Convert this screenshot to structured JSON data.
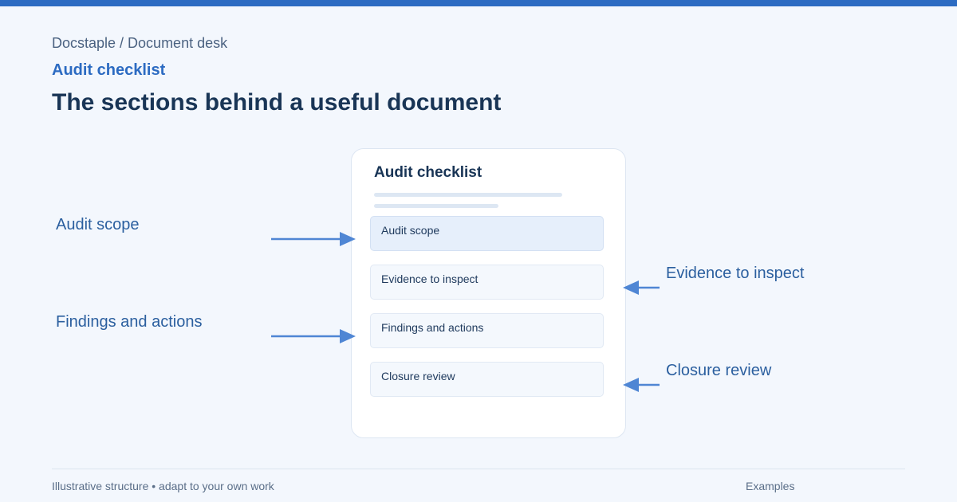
{
  "header": {
    "breadcrumb": "Docstaple / Document desk",
    "eyebrow": "Audit checklist",
    "title": "The sections behind a useful document"
  },
  "document": {
    "title": "Audit checklist",
    "sections": [
      {
        "label": "Audit scope"
      },
      {
        "label": "Evidence to inspect"
      },
      {
        "label": "Findings and actions"
      },
      {
        "label": "Closure review"
      }
    ]
  },
  "callouts": {
    "left": [
      "Audit scope",
      "Findings and actions"
    ],
    "right": [
      "Evidence to inspect",
      "Closure review"
    ]
  },
  "footer": {
    "note": "Illustrative structure • adapt to your own work",
    "link": "Examples"
  },
  "colors": {
    "accent": "#2c6bc2",
    "arrow": "#4f86d4",
    "background": "#f3f7fd"
  },
  "icons": {
    "arrow_right": "arrow-right-icon",
    "arrow_left": "arrow-left-icon"
  }
}
